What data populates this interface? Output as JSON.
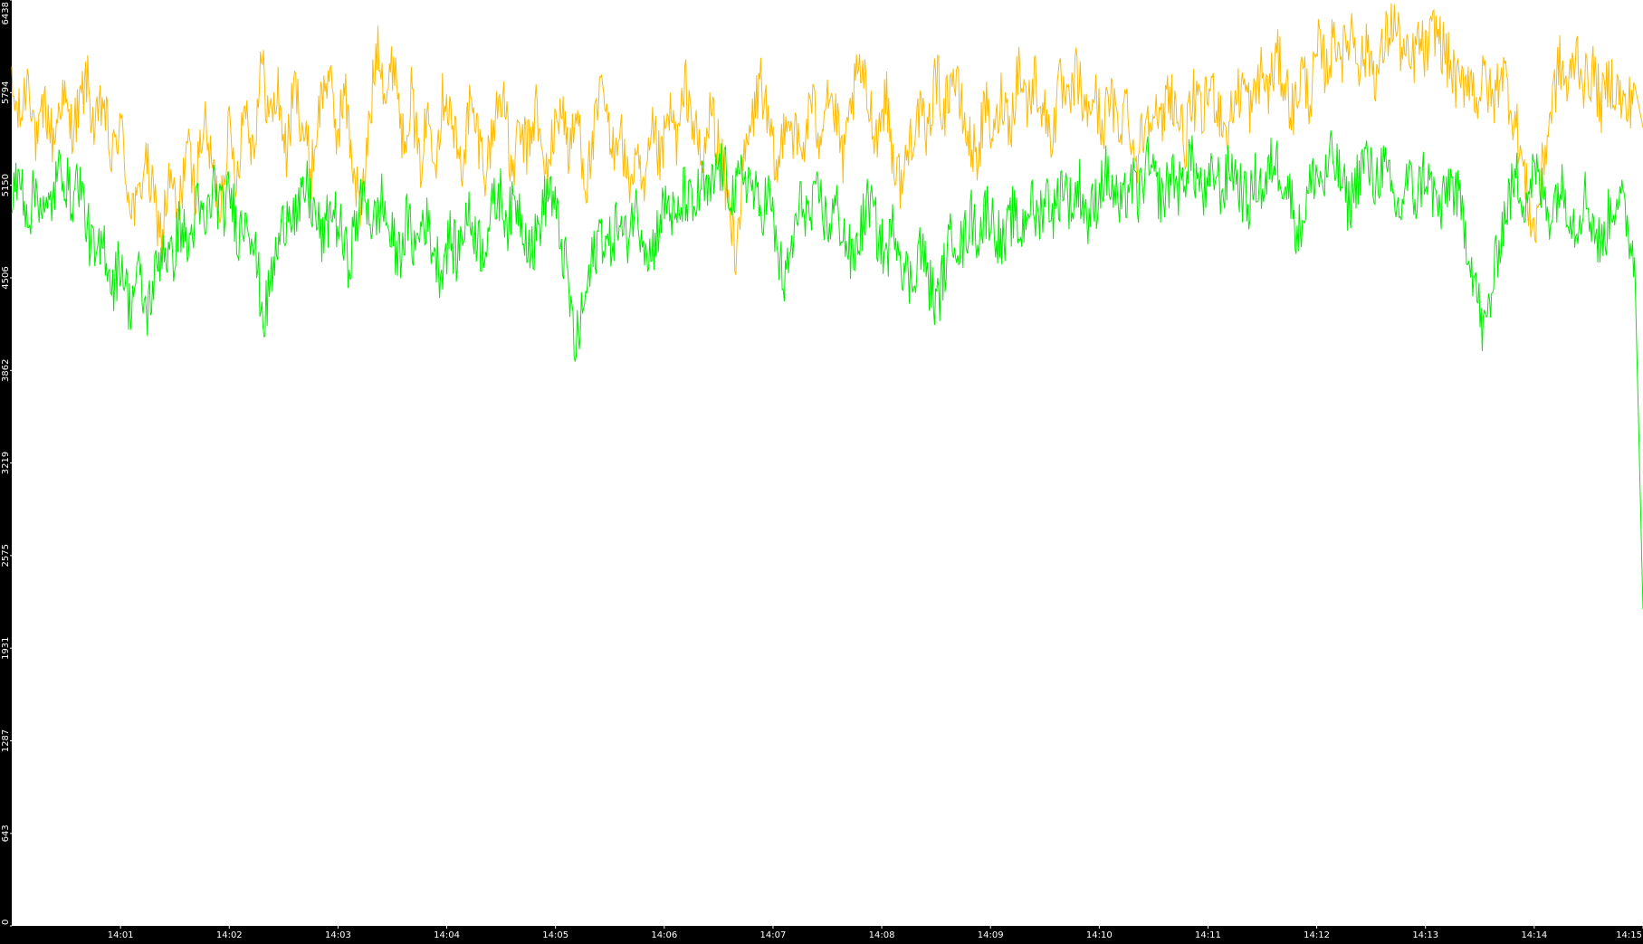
{
  "chart_data": {
    "type": "line",
    "title": "",
    "xlabel": "",
    "ylabel": "",
    "ylim": [
      0,
      6438
    ],
    "y_ticks": [
      "0",
      "643",
      "1287",
      "1931",
      "2575",
      "3219",
      "3862",
      "4506",
      "5150",
      "5794",
      "6438"
    ],
    "x_ticks": [
      "14:01",
      "14:02",
      "14:03",
      "14:04",
      "14:05",
      "14:06",
      "14:07",
      "14:08",
      "14:09",
      "14:10",
      "14:11",
      "14:12",
      "14:13",
      "14:14",
      "14:15"
    ],
    "x_range": [
      "14:00:00",
      "14:15:00"
    ],
    "grid": false,
    "background": "#ffffff",
    "frame_color": "#000000",
    "series": [
      {
        "color": "#ffbb00",
        "time_start": "14:00:00",
        "time_end": "14:15:00",
        "values": [
          5790,
          5600,
          5950,
          5400,
          5700,
          5450,
          5800,
          5550,
          5650,
          5900,
          5500,
          5750,
          5300,
          5600,
          5100,
          4950,
          5350,
          5050,
          4800,
          5200,
          4900,
          5450,
          5100,
          5600,
          5300,
          5000,
          5550,
          5200,
          5750,
          5400,
          6000,
          5600,
          5800,
          5350,
          5850,
          5550,
          5250,
          5700,
          5950,
          5500,
          5800,
          5300,
          4950,
          5600,
          6200,
          5750,
          6050,
          5450,
          5800,
          5250,
          5650,
          5400,
          5850,
          5550,
          5250,
          5700,
          5500,
          5250,
          5600,
          5850,
          5200,
          5500,
          5400,
          5700,
          5200,
          5450,
          5750,
          5350,
          5650,
          5150,
          5500,
          5850,
          5350,
          5600,
          5150,
          5300,
          5050,
          5500,
          5300,
          5650,
          5450,
          5850,
          5550,
          5250,
          5700,
          5400,
          5050,
          4700,
          5300,
          5600,
          5900,
          5500,
          5200,
          5700,
          5500,
          5350,
          5750,
          5500,
          5850,
          5600,
          5300,
          5750,
          5950,
          5700,
          5500,
          5800,
          5300,
          5150,
          5500,
          5650,
          5450,
          5950,
          5650,
          5950,
          5700,
          5450,
          5350,
          5700,
          5450,
          5800,
          5550,
          6000,
          5700,
          5900,
          5650,
          5500,
          5850,
          5650,
          5950,
          5600,
          5800,
          5550,
          5750,
          5550,
          5750,
          5300,
          5550,
          5750,
          5500,
          5850,
          5650,
          5450,
          5750,
          5600,
          5850,
          5700,
          5500,
          5750,
          5850,
          5650,
          5950,
          5800,
          6050,
          5850,
          5650,
          5950,
          5750,
          6100,
          5950,
          6200,
          6050,
          6250,
          6000,
          6100,
          5900,
          6150,
          6300,
          6100,
          5950,
          6150,
          6050,
          6250,
          6100,
          5950,
          5800,
          5950,
          5750,
          5900,
          5700,
          6000,
          5750,
          5500,
          5100,
          4800,
          5300,
          5700,
          6000,
          5800,
          6100,
          5850,
          5950,
          5700,
          5900,
          5800,
          5650,
          5850,
          5550
        ]
      },
      {
        "color": "#00ee00",
        "time_start": "14:00:00",
        "time_end": "14:15:00",
        "values": [
          5050,
          5200,
          4950,
          5150,
          4900,
          5100,
          5300,
          5050,
          5200,
          4850,
          4600,
          4750,
          4450,
          4650,
          4300,
          4550,
          4250,
          4500,
          4750,
          4600,
          4900,
          4700,
          5000,
          4850,
          5150,
          4950,
          5100,
          4800,
          5000,
          4650,
          4200,
          4550,
          4800,
          5050,
          4900,
          5150,
          4950,
          4750,
          5000,
          4850,
          4600,
          4900,
          5100,
          4850,
          5050,
          4800,
          4650,
          4900,
          4700,
          4950,
          4750,
          4550,
          4800,
          4650,
          4950,
          4850,
          4700,
          4950,
          5100,
          4900,
          5050,
          4850,
          4700,
          4950,
          5150,
          4850,
          4550,
          4000,
          4300,
          4600,
          4850,
          4700,
          4900,
          4750,
          5000,
          4850,
          4650,
          4900,
          5050,
          4850,
          5100,
          4950,
          5150,
          5050,
          5300,
          5200,
          5050,
          5250,
          5150,
          4950,
          5100,
          4700,
          4450,
          4800,
          5050,
          4900,
          5100,
          4850,
          5000,
          4800,
          4600,
          4850,
          5050,
          4800,
          4650,
          4900,
          4600,
          4450,
          4750,
          4500,
          4300,
          4600,
          4850,
          4700,
          4950,
          4800,
          5000,
          4850,
          4700,
          4950,
          4800,
          5050,
          4900,
          5100,
          4950,
          5200,
          5000,
          5150,
          4900,
          5050,
          5250,
          5100,
          4950,
          5200,
          5050,
          5300,
          5150,
          5050,
          5250,
          5100,
          5350,
          5200,
          5050,
          5250,
          5100,
          5300,
          5150,
          5000,
          5200,
          5100,
          5350,
          5250,
          5100,
          4800,
          5050,
          5250,
          5150,
          5350,
          5200,
          5000,
          5200,
          5350,
          5150,
          5300,
          5100,
          4950,
          5200,
          5050,
          5250,
          5100,
          4950,
          5200,
          5050,
          4800,
          4500,
          4100,
          4400,
          4800,
          5050,
          5200,
          5050,
          5250,
          5100,
          4950,
          5150,
          5050,
          4850,
          5100,
          4900,
          4700,
          4950,
          5100,
          4900,
          4650,
          2200
        ]
      }
    ]
  }
}
